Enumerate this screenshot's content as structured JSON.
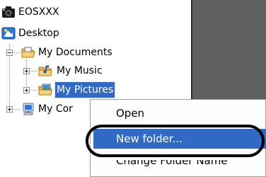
{
  "tree": {
    "items": [
      {
        "label": "EOSXXX",
        "icon": "camera-icon"
      },
      {
        "label": "Desktop",
        "icon": "desktop-icon"
      },
      {
        "label": "My Documents",
        "icon": "folder-open-icon"
      },
      {
        "label": "My Music",
        "icon": "music-folder-icon"
      },
      {
        "label": "My Pictures",
        "icon": "pictures-folder-icon"
      },
      {
        "label": "My Cor",
        "icon": "computer-icon"
      }
    ]
  },
  "context_menu": {
    "items": [
      {
        "label": "Open"
      },
      {
        "label": "New folder..."
      },
      {
        "label": "Change Folder Name"
      }
    ]
  },
  "colors": {
    "selection": "#316ac5",
    "annotation_ring": "#000000",
    "dark_pane": "#5f5f5f"
  }
}
